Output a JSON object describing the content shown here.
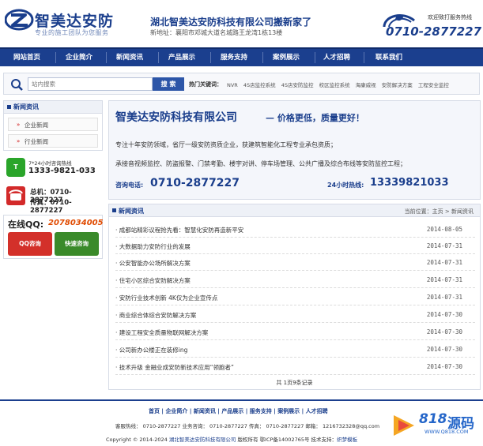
{
  "header": {
    "logo_cn": "智美达安防",
    "logo_slogan": "专业的施工团队为您服务",
    "move_title": "湖北智美达安防科技有限公司搬新家了",
    "move_addr": "新地址：襄阳市邓城大道名城路王龙湾1栋13楼",
    "welcome": "欢迎致打服务热线",
    "hotline": "0710-2877227"
  },
  "nav": [
    "网站首页",
    "企业简介",
    "新闻资讯",
    "产品展示",
    "服务支持",
    "案例展示",
    "人才招聘",
    "联系我们"
  ],
  "search": {
    "placeholder": "站内搜索",
    "button": "搜 索",
    "hot_label": "热门关键词：",
    "hot_words": [
      "NVR",
      "4S店监控系统",
      "4S店安防监控",
      "校区监控系统",
      "海康威视",
      "安防解决方案",
      "工程安全监控"
    ]
  },
  "sidebar": {
    "title": "新闻资讯",
    "links": [
      "企业新闻",
      "行业新闻"
    ],
    "hot_label": "7*24小时咨询热线",
    "hot_num": "1333-9821-033",
    "zj": "总机：0710-2877227",
    "cz": "传真：0710-2877227",
    "qq_title": "在线QQ:",
    "qq_num": "2078034005",
    "qq_btn1": "QQ咨询",
    "qq_btn2": "快速咨询"
  },
  "banner": {
    "title": "智美达安防科技有限公司",
    "sub": "— 价格更低，质量更好！",
    "line1": "专注十年安防领域，省厅一级安防资质企业，获建筑智能化工程专业承包资质；",
    "line2": "承接音视频监控、防盗报警、门禁考勤、楼宇对讲、停车场管理、公共广播及综合布线等安防监控工程；",
    "tel_label": "咨询电话:",
    "tel": "0710-2877227",
    "h24_label": "24小时热线:",
    "h24": "13339821033"
  },
  "news": {
    "title": "新闻资讯",
    "crumb": "当前位置：主页 > 新闻资讯",
    "items": [
      {
        "title": "· 成都站精彩议程抢先看：智慧化安防再造新平安",
        "date": "2014-08-05"
      },
      {
        "title": "· 大数据助力安防行业的发展",
        "date": "2014-07-31"
      },
      {
        "title": "· 公安智能办公场所解决方案",
        "date": "2014-07-31"
      },
      {
        "title": "· 住宅小区综合安防解决方案",
        "date": "2014-07-31"
      },
      {
        "title": "· 安防行业技术创新 4K仅为企业宣传点",
        "date": "2014-07-31"
      },
      {
        "title": "· 商业综合体综合安防解决方案",
        "date": "2014-07-30"
      },
      {
        "title": "· 建设工程安全质量物联网解决方案",
        "date": "2014-07-30"
      },
      {
        "title": "· 公司新办公楼正在装修ing",
        "date": "2014-07-30"
      },
      {
        "title": "· 技术升级   金融业成安防新技术应用“领跑者”",
        "date": "2014-07-30"
      }
    ],
    "pager": "共 1页9条记录"
  },
  "footer": {
    "links": [
      "首页",
      "企业简介",
      "新闻资讯",
      "产品展示",
      "服务支持",
      "案例展示",
      "人才招聘"
    ],
    "line2": "客服热线：   0710-2877227    业务咨询：   0710-2877227    传真：   0710-2877227    邮箱：   1216732328@qq.com",
    "line3_a": "Copyright © 2014-2024 ",
    "line3_b": "湖北智美达安防科技有限公司",
    "line3_c": " 版权所有 鄂ICP备14002765号 技术支持：",
    "line3_d": "织梦模板"
  },
  "watermark": {
    "num": "818",
    "cn": "源码",
    "url": "WWW.Q818.COM"
  },
  "colors": {
    "brand": "#1a3e8c",
    "nav": "#1b3f8e",
    "accent": "#e04a00"
  }
}
